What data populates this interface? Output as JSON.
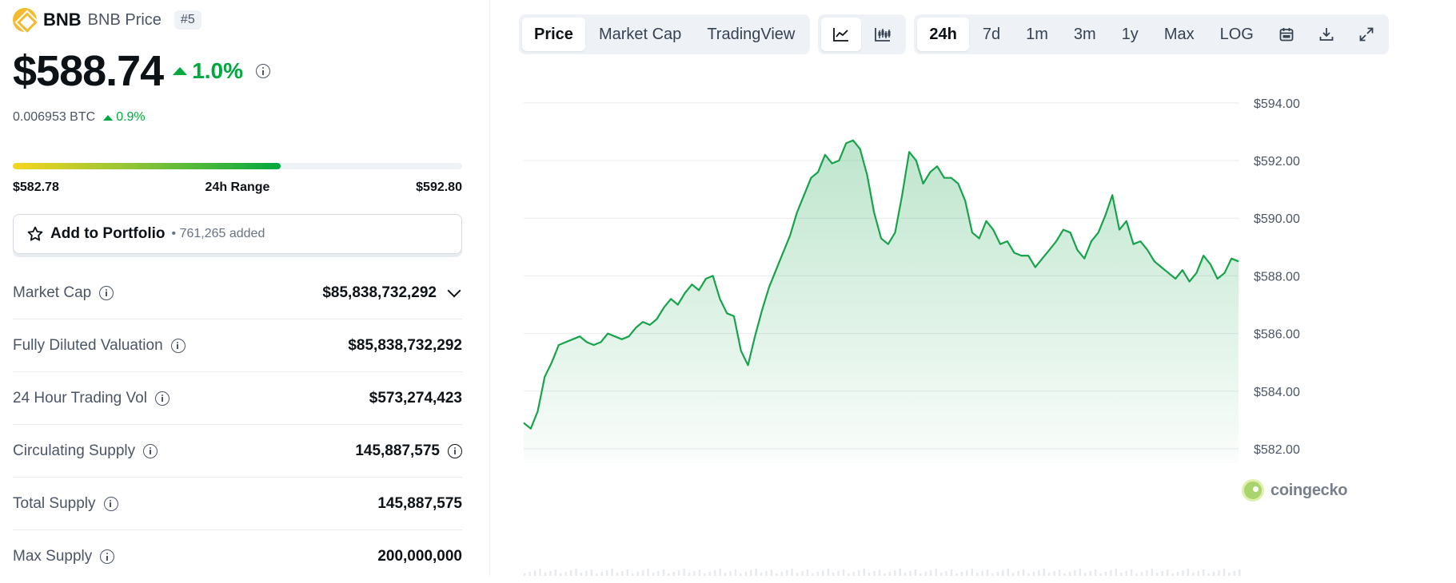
{
  "coin": {
    "symbol": "BNB",
    "name": "BNB Price",
    "rank": "#5",
    "price": "$588.74",
    "change_24h": "1.0%",
    "btc_price": "0.006953 BTC",
    "btc_change": "0.9%",
    "range": {
      "low": "$582.78",
      "label": "24h Range",
      "high": "$592.80",
      "fill_fraction": 0.596
    },
    "portfolio": {
      "label": "Add to Portfolio",
      "count": "• 761,265 added"
    },
    "stats": [
      {
        "label": "Market Cap",
        "value": "$85,838,732,292",
        "suffix": "chevron-down"
      },
      {
        "label": "Fully Diluted Valuation",
        "value": "$85,838,732,292"
      },
      {
        "label": "24 Hour Trading Vol",
        "value": "$573,274,423"
      },
      {
        "label": "Circulating Supply",
        "value": "145,887,575",
        "suffix": "info"
      },
      {
        "label": "Total Supply",
        "value": "145,887,575"
      },
      {
        "label": "Max Supply",
        "value": "200,000,000"
      }
    ]
  },
  "toolbar": {
    "view_tabs": [
      "Price",
      "Market Cap",
      "TradingView"
    ],
    "active_view": "Price",
    "chart_types": [
      "line-chart-icon",
      "candlestick-icon"
    ],
    "active_chart_type": "line-chart-icon",
    "ranges": [
      "24h",
      "7d",
      "1m",
      "3m",
      "1y",
      "Max",
      "LOG"
    ],
    "active_range": "24h",
    "tools": [
      "calendar-icon",
      "download-icon",
      "expand-icon"
    ]
  },
  "colors": {
    "up": "#00a83e",
    "line": "#16a34a",
    "brand": "#f3ba2f"
  },
  "watermark": "coingecko",
  "chart_data": {
    "type": "area",
    "title": "",
    "xlabel": "",
    "ylabel": "",
    "y_ticks": [
      "$594.00",
      "$592.00",
      "$590.00",
      "$588.00",
      "$586.00",
      "$584.00",
      "$582.00"
    ],
    "ylim": [
      581.5,
      594.3
    ],
    "grid": true,
    "series": [
      {
        "values": [
          582.9,
          582.7,
          583.3,
          584.5,
          585.0,
          585.6,
          585.7,
          585.8,
          585.9,
          585.7,
          585.6,
          585.7,
          586.0,
          585.9,
          585.8,
          585.9,
          586.2,
          586.4,
          586.3,
          586.5,
          586.9,
          587.2,
          587.0,
          587.4,
          587.7,
          587.5,
          587.9,
          588.0,
          587.2,
          586.7,
          586.6,
          585.4,
          584.9,
          585.9,
          586.8,
          587.6,
          588.2,
          588.8,
          589.4,
          590.2,
          590.8,
          591.4,
          591.6,
          592.2,
          591.9,
          592.0,
          592.6,
          592.7,
          592.4,
          591.5,
          590.2,
          589.3,
          589.1,
          589.5,
          590.8,
          592.3,
          592.0,
          591.2,
          591.6,
          591.8,
          591.4,
          591.4,
          591.2,
          590.6,
          589.5,
          589.3,
          589.9,
          589.6,
          589.1,
          589.2,
          588.8,
          588.7,
          588.7,
          588.3,
          588.6,
          588.9,
          589.2,
          589.6,
          589.5,
          588.9,
          588.6,
          589.2,
          589.5,
          590.1,
          590.8,
          589.6,
          589.9,
          589.1,
          589.2,
          588.9,
          588.5,
          588.3,
          588.1,
          587.9,
          588.2,
          587.8,
          588.1,
          588.7,
          588.4,
          587.9,
          588.1,
          588.6,
          588.5
        ]
      }
    ]
  }
}
